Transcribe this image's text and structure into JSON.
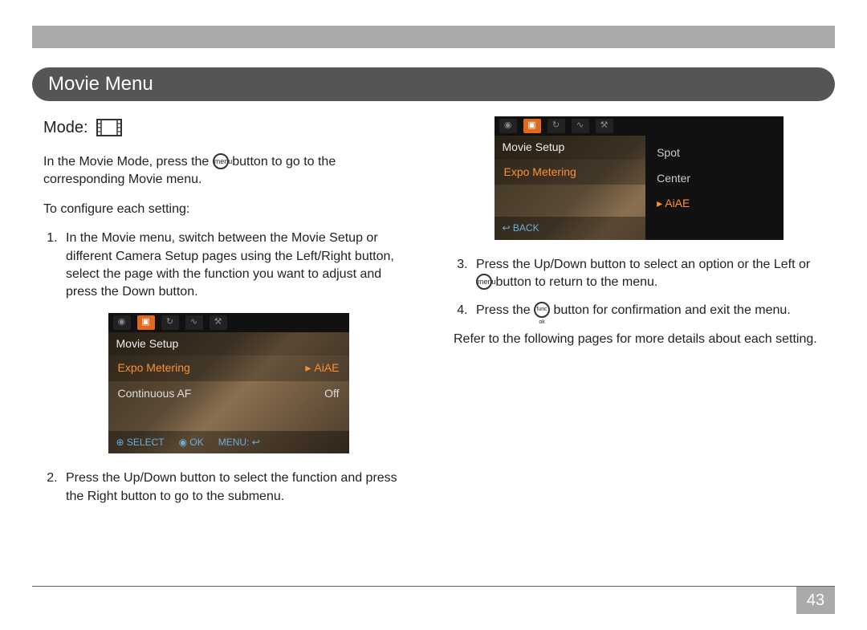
{
  "section_title": "Movie Menu",
  "mode_label": "Mode:",
  "intro_before": "In the Movie Mode, press the ",
  "intro_after": " button to go to the corresponding Movie menu.",
  "menu_icon_label": "menu",
  "configure_heading": "To configure each setting:",
  "left_steps": {
    "s1": "In the Movie menu, switch between the Movie Setup or different Camera Setup pages using the Left/Right button, select the page with the function you want to adjust and press the Down button.",
    "s2": "Press the Up/Down button to select the function and press the Right button to go to the submenu."
  },
  "right_steps": {
    "s3_before": "Press the Up/Down button to select an option or the Left or ",
    "s3_after": " button to return to the menu.",
    "s4_before": "Press the ",
    "s4_after": " button for confirmation and exit the menu.",
    "func_ok_icon_label": "func ok"
  },
  "closing": "Refer to the following pages for more details about each setting.",
  "page_number": "43",
  "shot1": {
    "title": "Movie Setup",
    "row1_label": "Expo Metering",
    "row1_value": "AiAE",
    "row2_label": "Continuous AF",
    "row2_value": "Off",
    "footer_select": "SELECT",
    "footer_ok": "OK",
    "footer_menu": "MENU:"
  },
  "shot2": {
    "title": "Movie Setup",
    "left_label": "Expo Metering",
    "opt1": "Spot",
    "opt2": "Center",
    "opt3": "AiAE",
    "back": "BACK"
  }
}
